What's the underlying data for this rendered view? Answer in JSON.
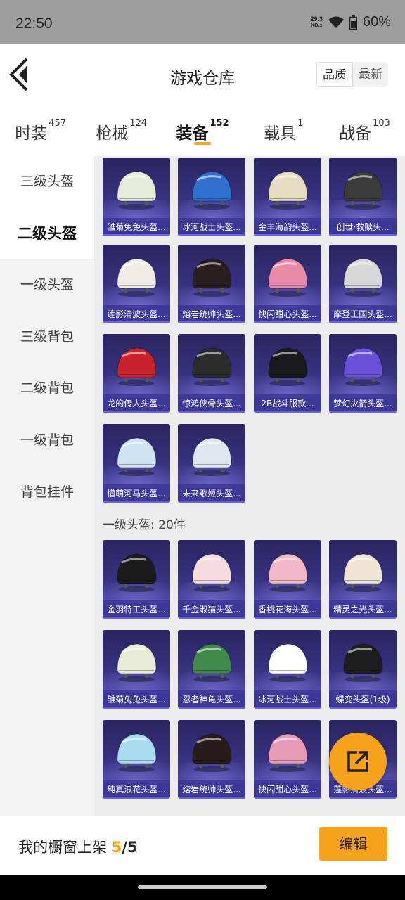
{
  "status_bar": {
    "time": "22:50",
    "net_speed": "29.3",
    "net_unit": "KB/s",
    "battery": "60%"
  },
  "header": {
    "title": "游戏仓库",
    "sort": [
      "品质",
      "最新"
    ]
  },
  "tabs": [
    {
      "label": "时装",
      "count": "457"
    },
    {
      "label": "枪械",
      "count": "124"
    },
    {
      "label": "装备",
      "count": "152"
    },
    {
      "label": "载具",
      "count": "1"
    },
    {
      "label": "战备",
      "count": "103"
    }
  ],
  "sidebar": [
    "三级头盔",
    "二级头盔",
    "一级头盔",
    "三级背包",
    "二级背包",
    "一级背包",
    "背包挂件"
  ],
  "section2_title": "一级头盔: 20件",
  "items": [
    {
      "label": "雏菊兔兔头盔...",
      "color": "#e7ebdc"
    },
    {
      "label": "冰河战士头盔...",
      "color": "#2f6fd0"
    },
    {
      "label": "金丰海韵头盔...",
      "color": "#e6dcc0"
    },
    {
      "label": "创世·救赎头...",
      "color": "#3b3b3b"
    },
    {
      "label": "莲影清波头盔...",
      "color": "#f2ece6"
    },
    {
      "label": "熔岩统帅头盔...",
      "color": "#2a1d1d"
    },
    {
      "label": "快闪甜心头盔...",
      "color": "#e88aa8"
    },
    {
      "label": "摩登王国头盔...",
      "color": "#d8d8d8"
    },
    {
      "label": "龙的传人头盔...",
      "color": "#c8232c"
    },
    {
      "label": "惊鸿侠骨头盔...",
      "color": "#2c2c2c"
    },
    {
      "label": "2B战斗服款...",
      "color": "#1a1a1a"
    },
    {
      "label": "梦幻火箭头盔...",
      "color": "#6a52d8"
    },
    {
      "label": "憎萌河马头盔...",
      "color": "#cfe3f2"
    },
    {
      "label": "未来歌姬头盔...",
      "color": "#e0e6f0"
    },
    {
      "label": "金羽特工头盔...",
      "color": "#1b1b1b"
    },
    {
      "label": "千金淑猫头盔...",
      "color": "#f6dbe2"
    },
    {
      "label": "香桃花海头盔...",
      "color": "#f3b8c5"
    },
    {
      "label": "精灵之光头盔...",
      "color": "#f0e4d4"
    },
    {
      "label": "雏菊兔兔头盔...",
      "color": "#e8ecd8"
    },
    {
      "label": "忍者神龟头盔...",
      "color": "#3f8a4a"
    },
    {
      "label": "冰河战士头盔...",
      "color": "#ffffff"
    },
    {
      "label": "蝶变头盔(1级)",
      "color": "#1e1e1e"
    },
    {
      "label": "纯真浪花头盔...",
      "color": "#a9dcf1"
    },
    {
      "label": "熔岩统帅头盔...",
      "color": "#2a1a1a"
    },
    {
      "label": "快闪甜心头盔...",
      "color": "#e79ab3"
    },
    {
      "label": "莲影清波头盔...",
      "color": "#f2ede6"
    }
  ],
  "bottom": {
    "shelf_label": "我的橱窗上架",
    "shelf_count": "5",
    "shelf_total": "/5",
    "edit_label": "编辑"
  }
}
